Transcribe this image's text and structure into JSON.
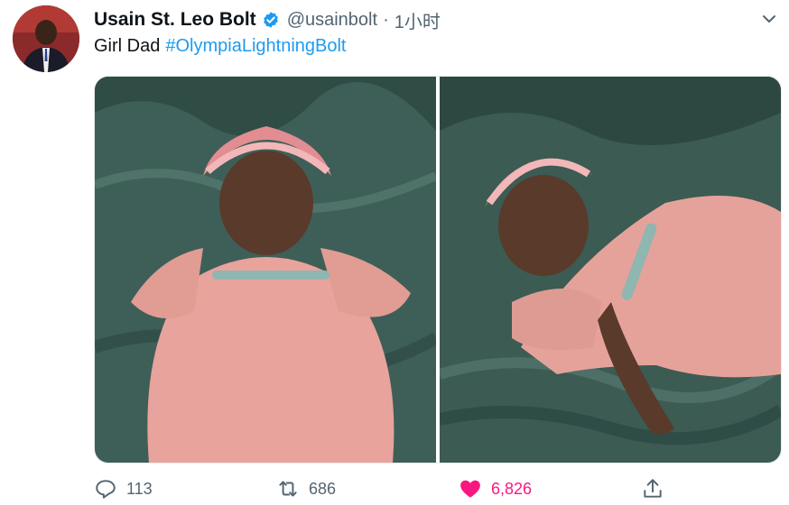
{
  "tweet": {
    "author_name": "Usain St. Leo Bolt",
    "handle": "@usainbolt",
    "separator": "·",
    "time": "1小时",
    "text": "Girl Dad",
    "hashtag": "#OlympiaLightningBolt"
  },
  "actions": {
    "reply_count": "113",
    "retweet_count": "686",
    "like_count": "6,826"
  },
  "icons": {
    "verified": "verified-badge-icon",
    "more": "chevron-down-icon",
    "reply": "reply-icon",
    "retweet": "retweet-icon",
    "like": "heart-icon",
    "share": "share-icon"
  },
  "colors": {
    "link": "#1d9bf0",
    "like": "#f91880",
    "muted": "#536471"
  }
}
